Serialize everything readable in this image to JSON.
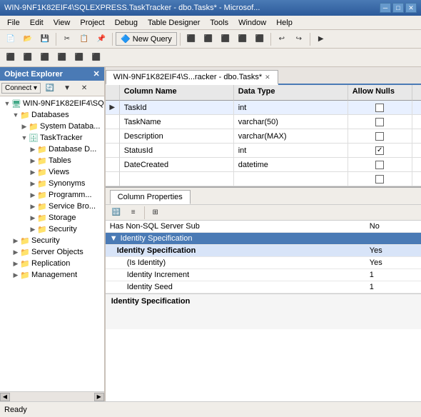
{
  "titleBar": {
    "text": "WIN-9NF1K82EIF4\\SQLEXPRESS.TaskTracker - dbo.Tasks* - Microsof...",
    "minBtn": "─",
    "maxBtn": "□",
    "closeBtn": "✕"
  },
  "menuBar": {
    "items": [
      "File",
      "Edit",
      "View",
      "Project",
      "Debug",
      "Table Designer",
      "Tools",
      "Window",
      "Help"
    ]
  },
  "objectExplorer": {
    "title": "Object Explorer",
    "connectBtn": "Connect ▾",
    "tree": [
      {
        "id": "server",
        "label": "WIN-9NF1K82EIF4\\SQ",
        "indent": 0,
        "expanded": true,
        "icon": "server"
      },
      {
        "id": "databases",
        "label": "Databases",
        "indent": 1,
        "expanded": true,
        "icon": "folder"
      },
      {
        "id": "systemdb",
        "label": "System Databa...",
        "indent": 2,
        "expanded": false,
        "icon": "folder"
      },
      {
        "id": "tasktracker",
        "label": "TaskTracker",
        "indent": 2,
        "expanded": true,
        "icon": "database"
      },
      {
        "id": "dbdiag",
        "label": "Database D...",
        "indent": 3,
        "expanded": false,
        "icon": "folder"
      },
      {
        "id": "tables",
        "label": "Tables",
        "indent": 3,
        "expanded": false,
        "icon": "folder"
      },
      {
        "id": "views",
        "label": "Views",
        "indent": 3,
        "expanded": false,
        "icon": "folder"
      },
      {
        "id": "synonyms",
        "label": "Synonyms",
        "indent": 3,
        "expanded": false,
        "icon": "folder"
      },
      {
        "id": "programmab",
        "label": "Programm...",
        "indent": 3,
        "expanded": false,
        "icon": "folder"
      },
      {
        "id": "servicebro",
        "label": "Service Bro...",
        "indent": 3,
        "expanded": false,
        "icon": "folder"
      },
      {
        "id": "storage",
        "label": "Storage",
        "indent": 3,
        "expanded": false,
        "icon": "folder"
      },
      {
        "id": "security2",
        "label": "Security",
        "indent": 3,
        "expanded": false,
        "icon": "folder"
      },
      {
        "id": "security",
        "label": "Security",
        "indent": 1,
        "expanded": false,
        "icon": "folder"
      },
      {
        "id": "serverobj",
        "label": "Server Objects",
        "indent": 1,
        "expanded": false,
        "icon": "folder"
      },
      {
        "id": "replication",
        "label": "Replication",
        "indent": 1,
        "expanded": false,
        "icon": "folder"
      },
      {
        "id": "management",
        "label": "Management",
        "indent": 1,
        "expanded": false,
        "icon": "folder"
      }
    ]
  },
  "tabBar": {
    "tabs": [
      {
        "label": "WIN-9NF1K82EIF4\\S...racker - dbo.Tasks*",
        "active": true,
        "closeable": true
      }
    ]
  },
  "tableGrid": {
    "headers": [
      "Column Name",
      "Data Type",
      "Allow Nulls"
    ],
    "rows": [
      {
        "marker": "▶",
        "isKey": true,
        "name": "TaskId",
        "dataType": "int",
        "allowNulls": false
      },
      {
        "marker": "",
        "isKey": false,
        "name": "TaskName",
        "dataType": "varchar(50)",
        "allowNulls": false
      },
      {
        "marker": "",
        "isKey": false,
        "name": "Description",
        "dataType": "varchar(MAX)",
        "allowNulls": false
      },
      {
        "marker": "",
        "isKey": false,
        "name": "StatusId",
        "dataType": "int",
        "allowNulls": true
      },
      {
        "marker": "",
        "isKey": false,
        "name": "DateCreated",
        "dataType": "datetime",
        "allowNulls": false
      },
      {
        "marker": "",
        "isKey": false,
        "name": "",
        "dataType": "",
        "allowNulls": false
      }
    ]
  },
  "columnProperties": {
    "tabLabel": "Column Properties",
    "properties": [
      {
        "type": "row",
        "label": "Has Non-SQL Server Sub",
        "value": "No",
        "indent": 0
      },
      {
        "type": "category",
        "label": "Identity Specification"
      },
      {
        "type": "row",
        "label": "Identity Specification",
        "value": "Yes",
        "indent": 0,
        "selected": true
      },
      {
        "type": "row",
        "label": "(Is Identity)",
        "value": "Yes",
        "indent": 1
      },
      {
        "type": "row",
        "label": "Identity Increment",
        "value": "1",
        "indent": 1
      },
      {
        "type": "row",
        "label": "Identity Seed",
        "value": "1",
        "indent": 1
      }
    ],
    "bottomLabel": "Identity Specification"
  },
  "statusBar": {
    "text": "Ready"
  }
}
